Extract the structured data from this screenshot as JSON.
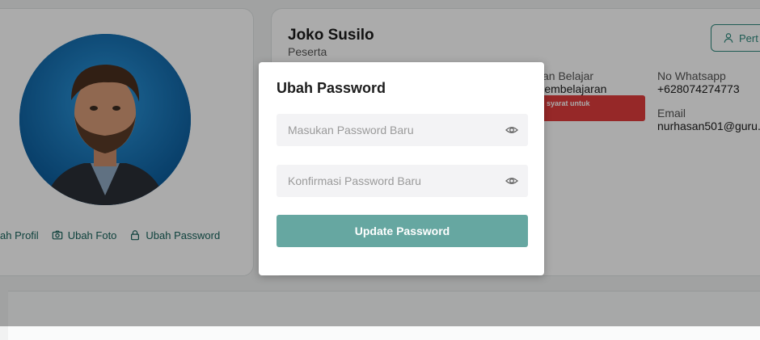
{
  "profile": {
    "name": "Joko Susilo",
    "role": "Peserta",
    "edit_button": "Pert",
    "actions": [
      {
        "label": "ah Profil",
        "icon": "pencil-icon"
      },
      {
        "label": "Ubah Foto",
        "icon": "camera-icon"
      },
      {
        "label": "Ubah Password",
        "icon": "lock-icon"
      }
    ]
  },
  "info": {
    "learning_label": "san Belajar",
    "learning_value": "Pembelajaran",
    "badge_text": "i syarat untuk",
    "whatsapp_label": "No Whatsapp",
    "whatsapp_value": "+628074274773",
    "email_label": "Email",
    "email_value": "nurhasan501@guru."
  },
  "modal": {
    "title": "Ubah Password",
    "new_password_placeholder": "Masukan Password Baru",
    "confirm_password_placeholder": "Konfirmasi Password Baru",
    "submit_label": "Update Password"
  },
  "colors": {
    "accent": "#17635c",
    "button": "#66a7a1",
    "badge": "#e03c3c"
  }
}
